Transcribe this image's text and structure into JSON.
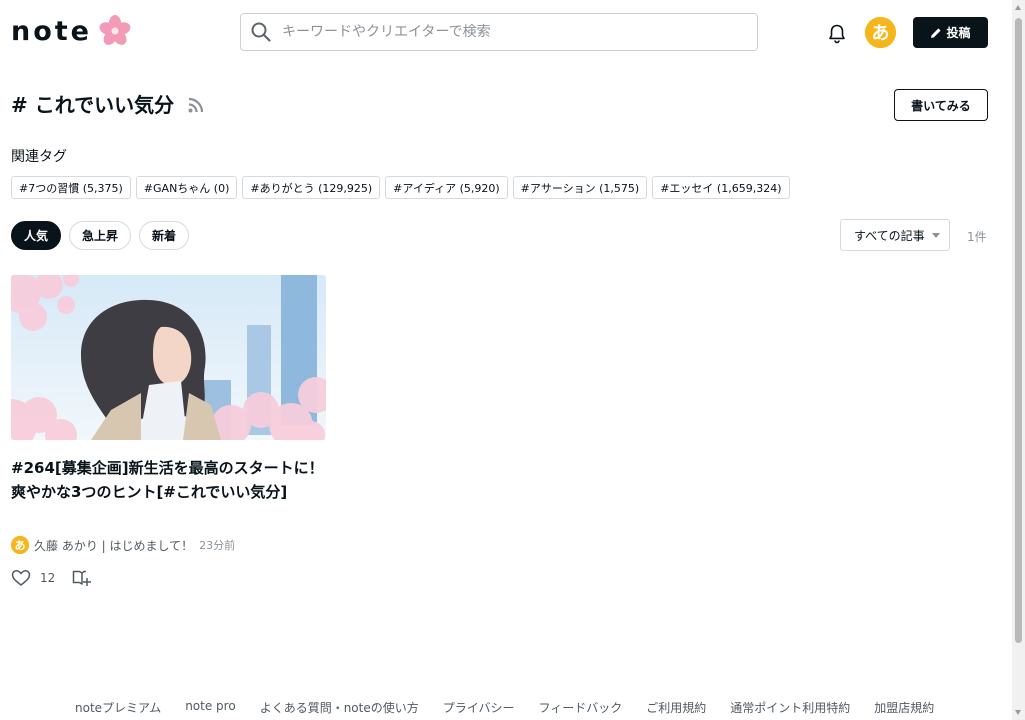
{
  "header": {
    "logo_text": "note",
    "search_placeholder": "キーワードやクリエイターで検索",
    "post_label": "投稿",
    "avatar_glyph": "あ"
  },
  "hashtag": {
    "title": "# これでいい気分",
    "write_label": "書いてみる"
  },
  "related": {
    "label": "関連タグ",
    "tags": [
      "#7つの習慣 (5,375)",
      "#GANちゃん (0)",
      "#ありがとう (129,925)",
      "#アイディア (5,920)",
      "#アサーション (1,575)",
      "#エッセイ (1,659,324)"
    ]
  },
  "sort": {
    "tabs": [
      "人気",
      "急上昇",
      "新着"
    ],
    "active_index": 0,
    "filter_label": "すべての記事",
    "count": "1件"
  },
  "article": {
    "title": "#264[募集企画]新生活を最高のスタートに！爽やかな3つのヒント[#これでいい気分]",
    "author": "久藤 あかり | はじめまして！",
    "time": "23分前",
    "likes": "12"
  },
  "footer": {
    "links": [
      "noteプレミアム",
      "note pro",
      "よくある質問・noteの使い方",
      "プライバシー",
      "フィードバック",
      "ご利用規約",
      "通常ポイント利用特約",
      "加盟店規約"
    ]
  },
  "colors": {
    "ink": "#08131a",
    "avatar": "#f5b51b",
    "sakura": "#f29bb6"
  }
}
